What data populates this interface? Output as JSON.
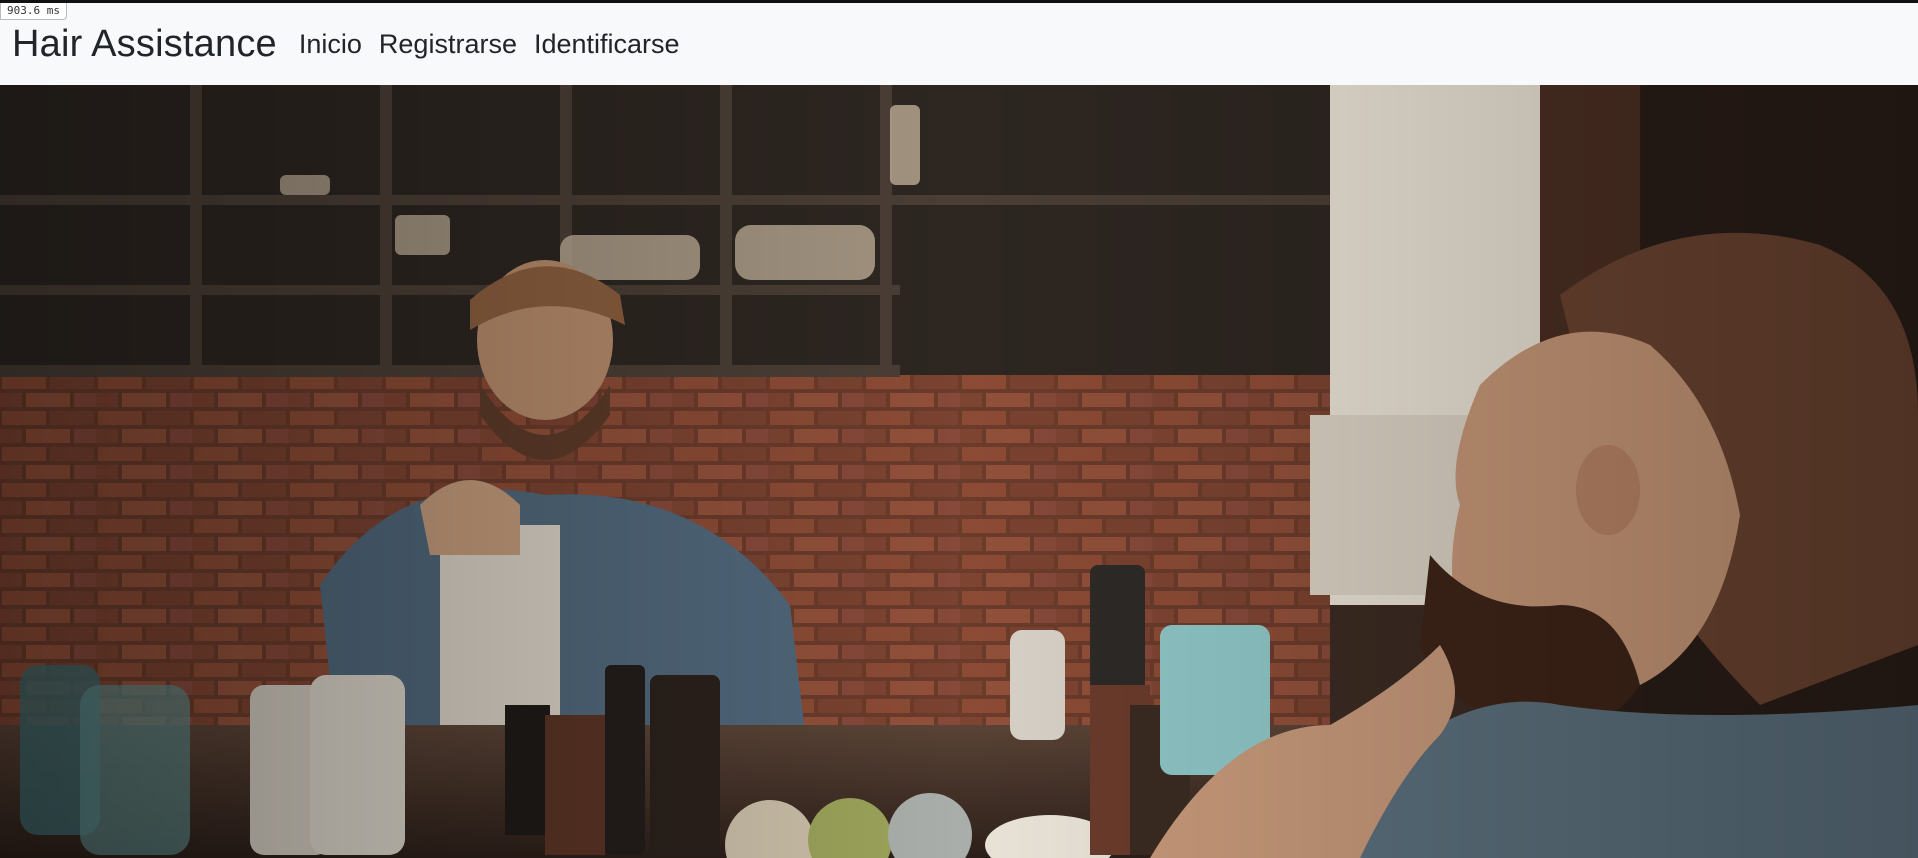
{
  "timing_badge": "903.6 ms",
  "navbar": {
    "brand": "Hair Assistance",
    "links": [
      {
        "label": "Inicio"
      },
      {
        "label": "Registrarse"
      },
      {
        "label": "Identificarse"
      }
    ]
  },
  "hero": {
    "image_alt": "barber shop photo"
  }
}
